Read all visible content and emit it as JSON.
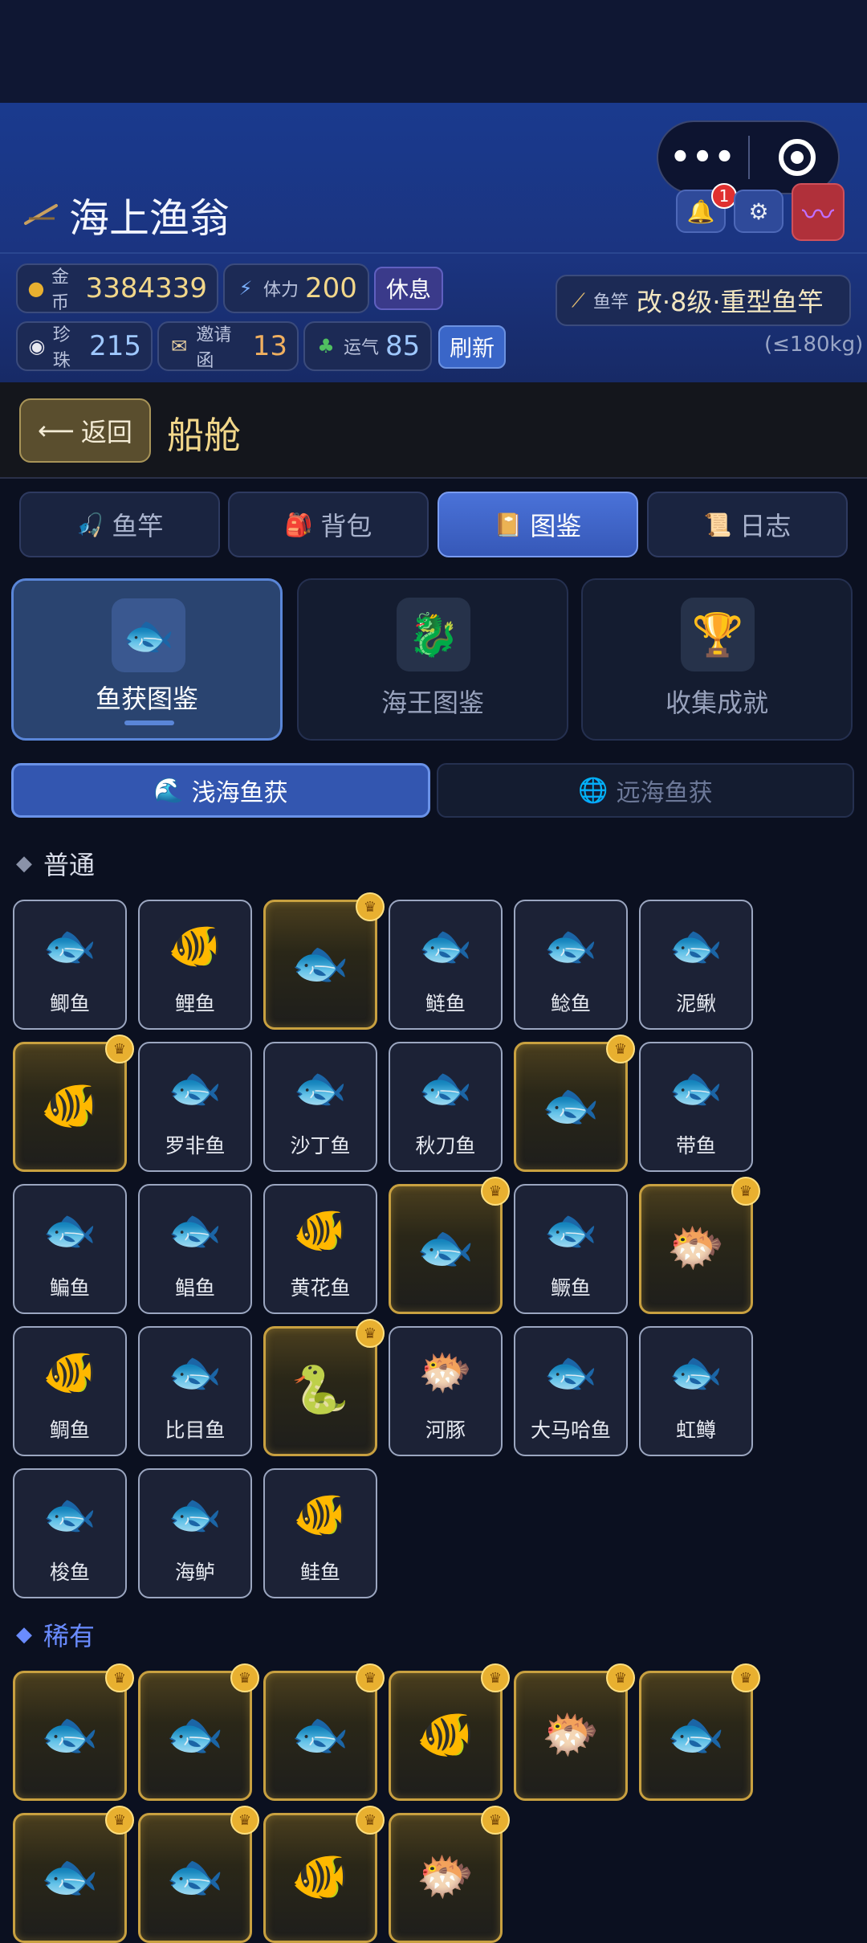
{
  "header": {
    "title": "海上渔翁",
    "notification_count": "1",
    "rest_label": "休息",
    "refresh_label": "刷新"
  },
  "stats": {
    "gold": {
      "label": "金币",
      "value": "3384339"
    },
    "stamina": {
      "label": "体力",
      "value": "200"
    },
    "pearl": {
      "label": "珍珠",
      "value": "215"
    },
    "invite": {
      "label": "邀请函",
      "value": "13"
    },
    "luck": {
      "label": "运气",
      "value": "85"
    }
  },
  "rod": {
    "label": "鱼竿",
    "value": "改·8级·重型鱼竿",
    "capacity": "(≤180kg)"
  },
  "nav": {
    "back_label": "返回",
    "title": "船舱"
  },
  "tabs": [
    "鱼竿",
    "背包",
    "图鉴",
    "日志"
  ],
  "categories": [
    "鱼获图鉴",
    "海王图鉴",
    "收集成就"
  ],
  "subtabs": [
    "浅海鱼获",
    "远海鱼获"
  ],
  "sections": {
    "common": "普通",
    "rare": "稀有"
  },
  "common_fish": [
    {
      "name": "鲫鱼",
      "icon": "🐟",
      "gold": false
    },
    {
      "name": "鲤鱼",
      "icon": "🐠",
      "gold": false
    },
    {
      "name": "",
      "icon": "🐟",
      "gold": true
    },
    {
      "name": "鲢鱼",
      "icon": "🐟",
      "gold": false
    },
    {
      "name": "鲶鱼",
      "icon": "🐟",
      "gold": false
    },
    {
      "name": "泥鳅",
      "icon": "🐟",
      "gold": false
    },
    {
      "name": "",
      "icon": "🐠",
      "gold": true
    },
    {
      "name": "罗非鱼",
      "icon": "🐟",
      "gold": false
    },
    {
      "name": "沙丁鱼",
      "icon": "🐟",
      "gold": false
    },
    {
      "name": "秋刀鱼",
      "icon": "🐟",
      "gold": false
    },
    {
      "name": "",
      "icon": "🐟",
      "gold": true
    },
    {
      "name": "带鱼",
      "icon": "🐟",
      "gold": false
    },
    {
      "name": "鳊鱼",
      "icon": "🐟",
      "gold": false
    },
    {
      "name": "鲳鱼",
      "icon": "🐟",
      "gold": false
    },
    {
      "name": "黄花鱼",
      "icon": "🐠",
      "gold": false
    },
    {
      "name": "",
      "icon": "🐟",
      "gold": true
    },
    {
      "name": "鳜鱼",
      "icon": "🐟",
      "gold": false
    },
    {
      "name": "",
      "icon": "🐡",
      "gold": true
    },
    {
      "name": "鲷鱼",
      "icon": "🐠",
      "gold": false
    },
    {
      "name": "比目鱼",
      "icon": "🐟",
      "gold": false
    },
    {
      "name": "",
      "icon": "🐍",
      "gold": true
    },
    {
      "name": "河豚",
      "icon": "🐡",
      "gold": false
    },
    {
      "name": "大马哈鱼",
      "icon": "🐟",
      "gold": false
    },
    {
      "name": "虹鳟",
      "icon": "🐟",
      "gold": false
    },
    {
      "name": "梭鱼",
      "icon": "🐟",
      "gold": false
    },
    {
      "name": "海鲈",
      "icon": "🐟",
      "gold": false
    },
    {
      "name": "鲑鱼",
      "icon": "🐠",
      "gold": false
    }
  ],
  "rare_fish": [
    {
      "name": "",
      "icon": "🐟",
      "gold": true
    },
    {
      "name": "",
      "icon": "🐟",
      "gold": true
    },
    {
      "name": "",
      "icon": "🐟",
      "gold": true
    },
    {
      "name": "",
      "icon": "🐠",
      "gold": true
    },
    {
      "name": "",
      "icon": "🐡",
      "gold": true
    },
    {
      "name": "",
      "icon": "🐟",
      "gold": true
    },
    {
      "name": "",
      "icon": "🐟",
      "gold": true
    },
    {
      "name": "",
      "icon": "🐟",
      "gold": true
    },
    {
      "name": "",
      "icon": "🐠",
      "gold": true
    },
    {
      "name": "",
      "icon": "🐡",
      "gold": true
    }
  ]
}
